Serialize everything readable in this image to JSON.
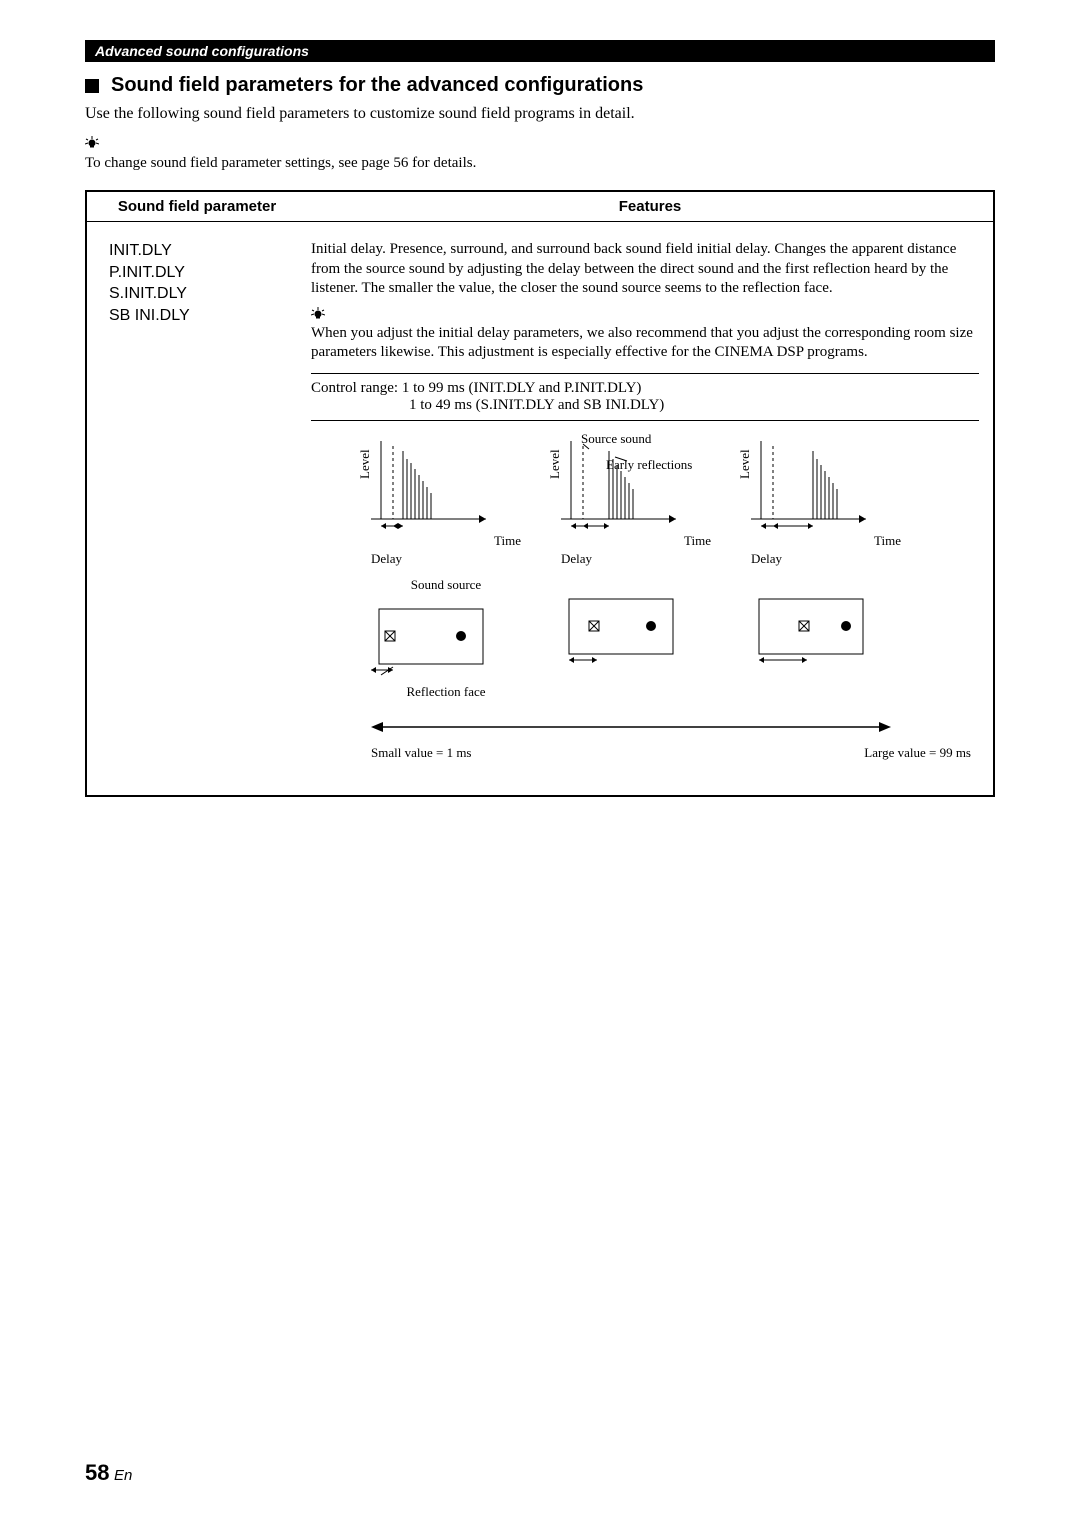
{
  "header": {
    "breadcrumb": "Advanced sound configurations"
  },
  "section": {
    "title": "Sound field parameters for the advanced configurations",
    "intro": "Use the following sound field parameters to customize sound field programs in detail.",
    "tip": "To change sound field parameter settings, see page 56 for details."
  },
  "table": {
    "headers": {
      "param": "Sound field parameter",
      "features": "Features"
    },
    "row": {
      "params": [
        "INIT.DLY",
        "P.INIT.DLY",
        "S.INIT.DLY",
        "SB INI.DLY"
      ],
      "description": "Initial delay. Presence, surround, and surround back sound field initial delay. Changes the apparent distance from the source sound by adjusting the delay between the direct sound and the first reflection heard by the listener. The smaller the value, the closer the sound source seems to the reflection face.",
      "tip": "When you adjust the initial delay parameters, we also recommend that you adjust the corresponding room size parameters likewise. This adjustment is especially effective for the CINEMA DSP programs.",
      "control_range_line1": "Control range: 1 to 99 ms (INIT.DLY and P.INIT.DLY)",
      "control_range_line2": "1 to 49 ms (S.INIT.DLY and SB INI.DLY)"
    }
  },
  "diagram": {
    "source_sound": "Source sound",
    "early_reflections": "Early reflections",
    "level": "Level",
    "time": "Time",
    "delay": "Delay",
    "sound_source": "Sound source",
    "reflection_face": "Reflection face",
    "small_value": "Small value = 1 ms",
    "large_value": "Large value = 99 ms"
  },
  "footer": {
    "page_number": "58",
    "lang": "En"
  }
}
